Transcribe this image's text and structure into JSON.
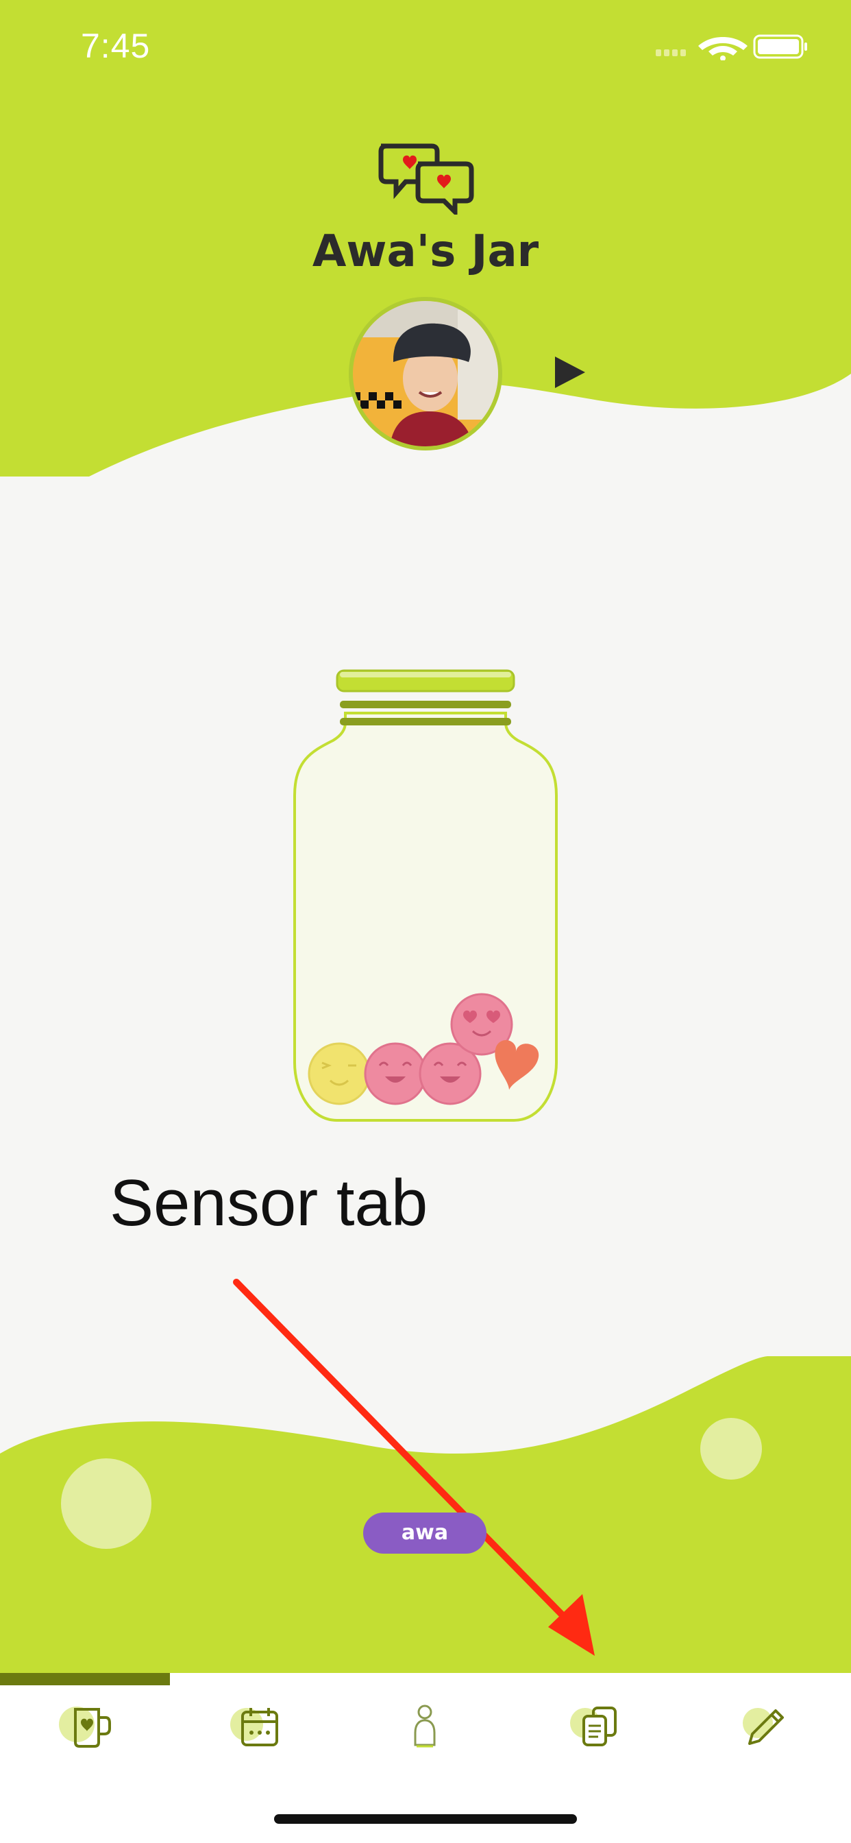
{
  "status_bar": {
    "time": "7:45"
  },
  "header": {
    "title": "Awa's Jar"
  },
  "annotation": {
    "text": "Sensor tab"
  },
  "footer": {
    "user_pill": "awa"
  },
  "tabs": [
    {
      "name": "jar",
      "icon": "mug-heart-icon"
    },
    {
      "name": "calendar",
      "icon": "calendar-icon"
    },
    {
      "name": "sensor",
      "icon": "person-icon"
    },
    {
      "name": "notes",
      "icon": "documents-icon"
    },
    {
      "name": "edit",
      "icon": "pencil-icon"
    }
  ],
  "colors": {
    "accent": "#c3de33",
    "tab_indicator": "#6b7a10",
    "pill": "#8a5cc4",
    "arrow": "#ff2a12"
  }
}
